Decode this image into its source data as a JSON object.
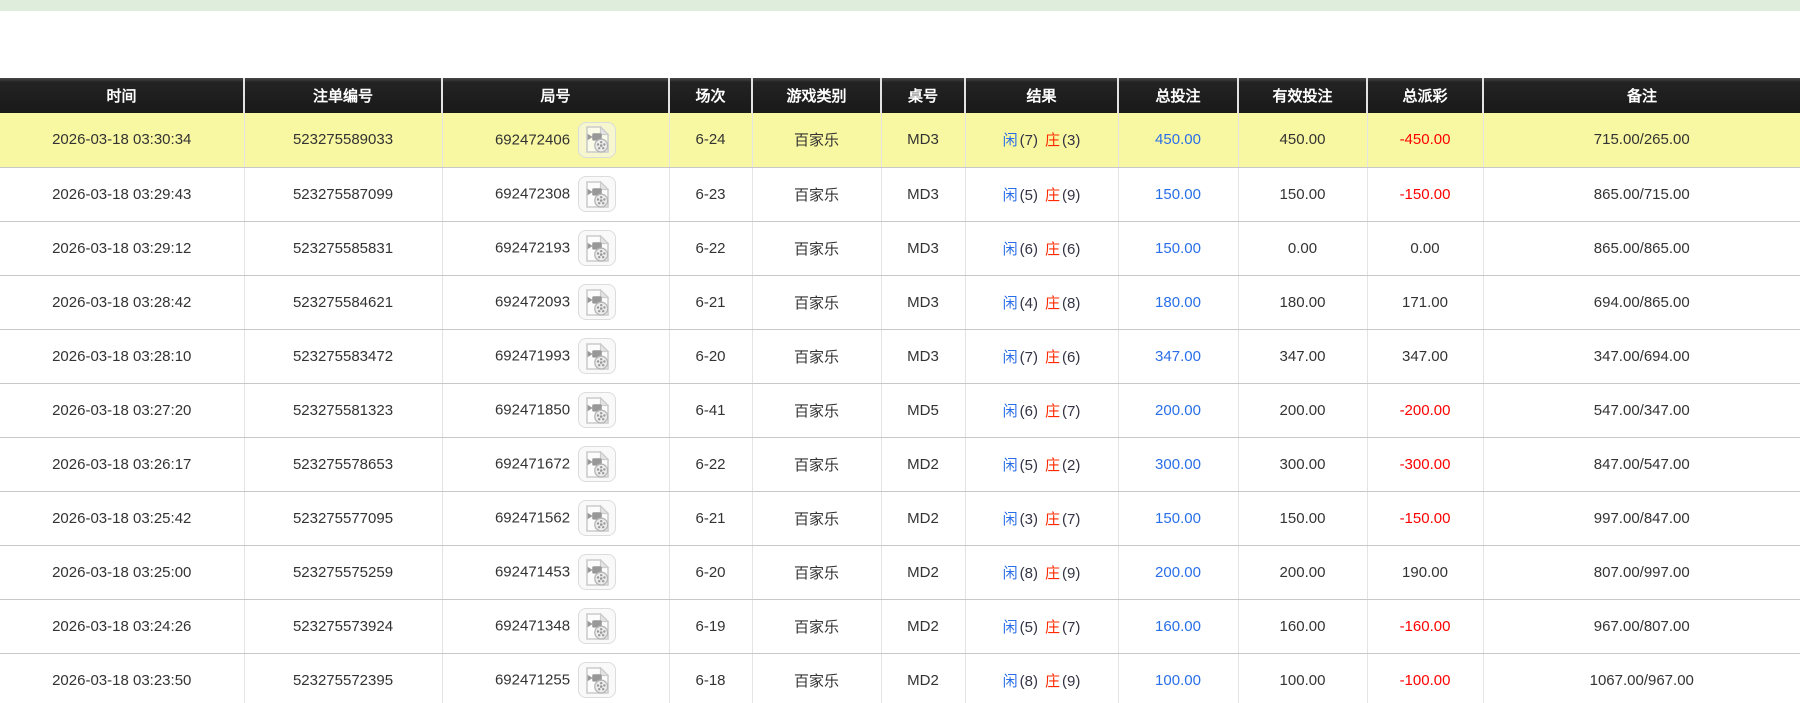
{
  "topbar": {
    "color": "#dfeedc"
  },
  "colors": {
    "header_bg": "#191919",
    "highlight_yellow": "#f9f8a2",
    "accent_blue": "#2a6fe8",
    "negative_red": "#ff0000",
    "banker_red": "#ff2a00",
    "topbar_green": "#dfeedc"
  },
  "icons": {
    "round_video": "video-file-icon"
  },
  "table": {
    "columns": [
      {
        "key": "time",
        "label": "时间"
      },
      {
        "key": "bet_id",
        "label": "注单编号"
      },
      {
        "key": "round_id",
        "label": "局号"
      },
      {
        "key": "session",
        "label": "场次"
      },
      {
        "key": "game",
        "label": "游戏类别"
      },
      {
        "key": "table_no",
        "label": "桌号"
      },
      {
        "key": "result",
        "label": "结果"
      },
      {
        "key": "total_bet",
        "label": "总投注"
      },
      {
        "key": "valid_bet",
        "label": "有效投注"
      },
      {
        "key": "payout",
        "label": "总派彩"
      },
      {
        "key": "remark",
        "label": "备注"
      }
    ],
    "rows": [
      {
        "time": "2026-03-18 03:30:34",
        "bet_id": "523275589033",
        "round_id": "692472406",
        "session": "6-24",
        "game": "百家乐",
        "table_no": "MD3",
        "player_label": "闲",
        "player_score": "(7)",
        "banker_label": "庄",
        "banker_score": "(3)",
        "total_bet": "450.00",
        "valid_bet": "450.00",
        "payout": "-450.00",
        "remark": "715.00/265.00",
        "highlighted": true
      },
      {
        "time": "2026-03-18 03:29:43",
        "bet_id": "523275587099",
        "round_id": "692472308",
        "session": "6-23",
        "game": "百家乐",
        "table_no": "MD3",
        "player_label": "闲",
        "player_score": "(5)",
        "banker_label": "庄",
        "banker_score": "(9)",
        "total_bet": "150.00",
        "valid_bet": "150.00",
        "payout": "-150.00",
        "remark": "865.00/715.00",
        "highlighted": false
      },
      {
        "time": "2026-03-18 03:29:12",
        "bet_id": "523275585831",
        "round_id": "692472193",
        "session": "6-22",
        "game": "百家乐",
        "table_no": "MD3",
        "player_label": "闲",
        "player_score": "(6)",
        "banker_label": "庄",
        "banker_score": "(6)",
        "total_bet": "150.00",
        "valid_bet": "0.00",
        "payout": "0.00",
        "remark": "865.00/865.00",
        "highlighted": false
      },
      {
        "time": "2026-03-18 03:28:42",
        "bet_id": "523275584621",
        "round_id": "692472093",
        "session": "6-21",
        "game": "百家乐",
        "table_no": "MD3",
        "player_label": "闲",
        "player_score": "(4)",
        "banker_label": "庄",
        "banker_score": "(8)",
        "total_bet": "180.00",
        "valid_bet": "180.00",
        "payout": "171.00",
        "remark": "694.00/865.00",
        "highlighted": false
      },
      {
        "time": "2026-03-18 03:28:10",
        "bet_id": "523275583472",
        "round_id": "692471993",
        "session": "6-20",
        "game": "百家乐",
        "table_no": "MD3",
        "player_label": "闲",
        "player_score": "(7)",
        "banker_label": "庄",
        "banker_score": "(6)",
        "total_bet": "347.00",
        "valid_bet": "347.00",
        "payout": "347.00",
        "remark": "347.00/694.00",
        "highlighted": false
      },
      {
        "time": "2026-03-18 03:27:20",
        "bet_id": "523275581323",
        "round_id": "692471850",
        "session": "6-41",
        "game": "百家乐",
        "table_no": "MD5",
        "player_label": "闲",
        "player_score": "(6)",
        "banker_label": "庄",
        "banker_score": "(7)",
        "total_bet": "200.00",
        "valid_bet": "200.00",
        "payout": "-200.00",
        "remark": "547.00/347.00",
        "highlighted": false
      },
      {
        "time": "2026-03-18 03:26:17",
        "bet_id": "523275578653",
        "round_id": "692471672",
        "session": "6-22",
        "game": "百家乐",
        "table_no": "MD2",
        "player_label": "闲",
        "player_score": "(5)",
        "banker_label": "庄",
        "banker_score": "(2)",
        "total_bet": "300.00",
        "valid_bet": "300.00",
        "payout": "-300.00",
        "remark": "847.00/547.00",
        "highlighted": false
      },
      {
        "time": "2026-03-18 03:25:42",
        "bet_id": "523275577095",
        "round_id": "692471562",
        "session": "6-21",
        "game": "百家乐",
        "table_no": "MD2",
        "player_label": "闲",
        "player_score": "(3)",
        "banker_label": "庄",
        "banker_score": "(7)",
        "total_bet": "150.00",
        "valid_bet": "150.00",
        "payout": "-150.00",
        "remark": "997.00/847.00",
        "highlighted": false
      },
      {
        "time": "2026-03-18 03:25:00",
        "bet_id": "523275575259",
        "round_id": "692471453",
        "session": "6-20",
        "game": "百家乐",
        "table_no": "MD2",
        "player_label": "闲",
        "player_score": "(8)",
        "banker_label": "庄",
        "banker_score": "(9)",
        "total_bet": "200.00",
        "valid_bet": "200.00",
        "payout": "190.00",
        "remark": "807.00/997.00",
        "highlighted": false
      },
      {
        "time": "2026-03-18 03:24:26",
        "bet_id": "523275573924",
        "round_id": "692471348",
        "session": "6-19",
        "game": "百家乐",
        "table_no": "MD2",
        "player_label": "闲",
        "player_score": "(5)",
        "banker_label": "庄",
        "banker_score": "(7)",
        "total_bet": "160.00",
        "valid_bet": "160.00",
        "payout": "-160.00",
        "remark": "967.00/807.00",
        "highlighted": false
      },
      {
        "time": "2026-03-18 03:23:50",
        "bet_id": "523275572395",
        "round_id": "692471255",
        "session": "6-18",
        "game": "百家乐",
        "table_no": "MD2",
        "player_label": "闲",
        "player_score": "(8)",
        "banker_label": "庄",
        "banker_score": "(9)",
        "total_bet": "100.00",
        "valid_bet": "100.00",
        "payout": "-100.00",
        "remark": "1067.00/967.00",
        "highlighted": false
      }
    ]
  }
}
